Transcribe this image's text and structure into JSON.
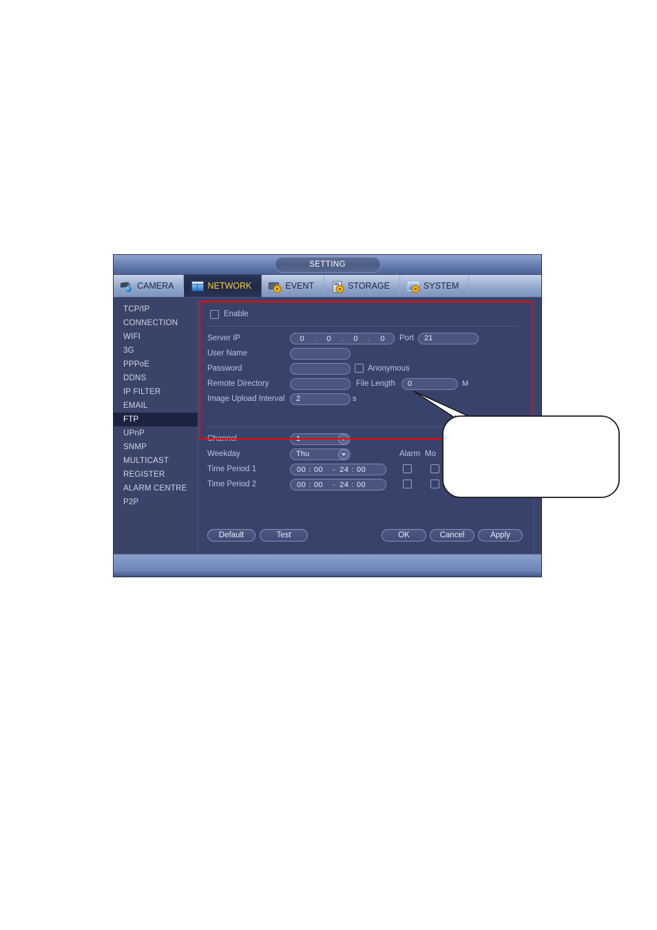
{
  "window": {
    "title": "SETTING",
    "footer_visible": true
  },
  "tabs": [
    {
      "label": "CAMERA",
      "icon": "camera-icon",
      "active": false
    },
    {
      "label": "NETWORK",
      "icon": "network-icon",
      "active": true
    },
    {
      "label": "EVENT",
      "icon": "event-icon",
      "active": false
    },
    {
      "label": "STORAGE",
      "icon": "storage-icon",
      "active": false
    },
    {
      "label": "SYSTEM",
      "icon": "system-icon",
      "active": false
    }
  ],
  "sidebar": {
    "selected": "FTP",
    "items": [
      {
        "label": "TCP/IP"
      },
      {
        "label": "CONNECTION"
      },
      {
        "label": "WIFI"
      },
      {
        "label": "3G"
      },
      {
        "label": "PPPoE"
      },
      {
        "label": "DDNS"
      },
      {
        "label": "IP FILTER"
      },
      {
        "label": "EMAIL"
      },
      {
        "label": "FTP"
      },
      {
        "label": "UPnP"
      },
      {
        "label": "SNMP"
      },
      {
        "label": "MULTICAST"
      },
      {
        "label": "REGISTER"
      },
      {
        "label": "ALARM CENTRE"
      },
      {
        "label": "P2P"
      }
    ]
  },
  "form": {
    "enable": {
      "label": "Enable",
      "checked": false
    },
    "server_ip": {
      "label": "Server IP",
      "octets": [
        "0",
        "0",
        "0",
        "0"
      ]
    },
    "port": {
      "label": "Port",
      "value": "21"
    },
    "user_name": {
      "label": "User Name",
      "value": ""
    },
    "password": {
      "label": "Password",
      "value": ""
    },
    "anonymous": {
      "label": "Anonymous",
      "checked": false
    },
    "remote_directory": {
      "label": "Remote Directory",
      "value": ""
    },
    "file_length": {
      "label": "File Length",
      "value": "0",
      "unit": "M"
    },
    "image_upload_interval": {
      "label": "Image Upload Interval",
      "value": "2",
      "unit": "s"
    },
    "channel": {
      "label": "Channel",
      "value": "1"
    },
    "weekday": {
      "label": "Weekday",
      "value": "Thu"
    },
    "column_headers": {
      "alarm": "Alarm",
      "motion": "Mo"
    },
    "time_periods": [
      {
        "label": "Time Period 1",
        "start_hour": "00",
        "start_min": "00",
        "end_hour": "24",
        "end_min": "00",
        "alarm_checked": false,
        "motion_checked": false
      },
      {
        "label": "Time Period 2",
        "start_hour": "00",
        "start_min": "00",
        "end_hour": "24",
        "end_min": "00",
        "alarm_checked": false,
        "motion_checked": false
      }
    ]
  },
  "buttons": {
    "default": "Default",
    "test": "Test",
    "ok": "OK",
    "cancel": "Cancel",
    "apply": "Apply"
  },
  "callout": {
    "text": ""
  },
  "colors": {
    "highlight_box": "#ff0000",
    "active_tab_text": "#f5d33a",
    "panel_bg": "#39426a",
    "window_bg": "#3a4468",
    "selected_sidebar_bg": "#1c2340"
  }
}
